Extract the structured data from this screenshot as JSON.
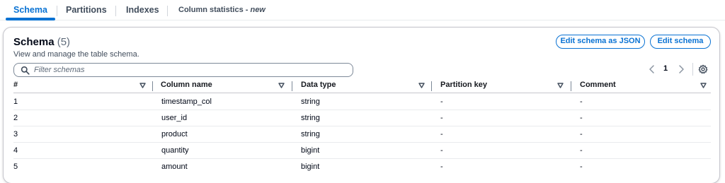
{
  "tabs": [
    {
      "label": "Schema",
      "active": true
    },
    {
      "label": "Partitions",
      "active": false
    },
    {
      "label": "Indexes",
      "active": false
    },
    {
      "label": "Column statistics - ",
      "suffix": "new",
      "active": false
    }
  ],
  "header": {
    "title": "Schema",
    "count": "(5)",
    "description": "View and manage the table schema."
  },
  "actions": {
    "edit_json_label": "Edit schema as JSON",
    "edit_label": "Edit schema"
  },
  "search": {
    "placeholder": "Filter schemas",
    "value": ""
  },
  "pagination": {
    "current_page": "1"
  },
  "table": {
    "columns": [
      "#",
      "Column name",
      "Data type",
      "Partition key",
      "Comment"
    ],
    "rows": [
      [
        "1",
        "timestamp_col",
        "string",
        "-",
        "-"
      ],
      [
        "2",
        "user_id",
        "string",
        "-",
        "-"
      ],
      [
        "3",
        "product",
        "string",
        "-",
        "-"
      ],
      [
        "4",
        "quantity",
        "bigint",
        "-",
        "-"
      ],
      [
        "5",
        "amount",
        "bigint",
        "-",
        "-"
      ]
    ]
  },
  "colors": {
    "accent": "#0972d3",
    "text": "#000716",
    "muted": "#5f6b7a",
    "border": "#c6c6cd"
  },
  "icons": [
    "search-icon",
    "chevron-left-icon",
    "chevron-right-icon",
    "settings-gear-icon",
    "sort-caret-down-icon"
  ]
}
